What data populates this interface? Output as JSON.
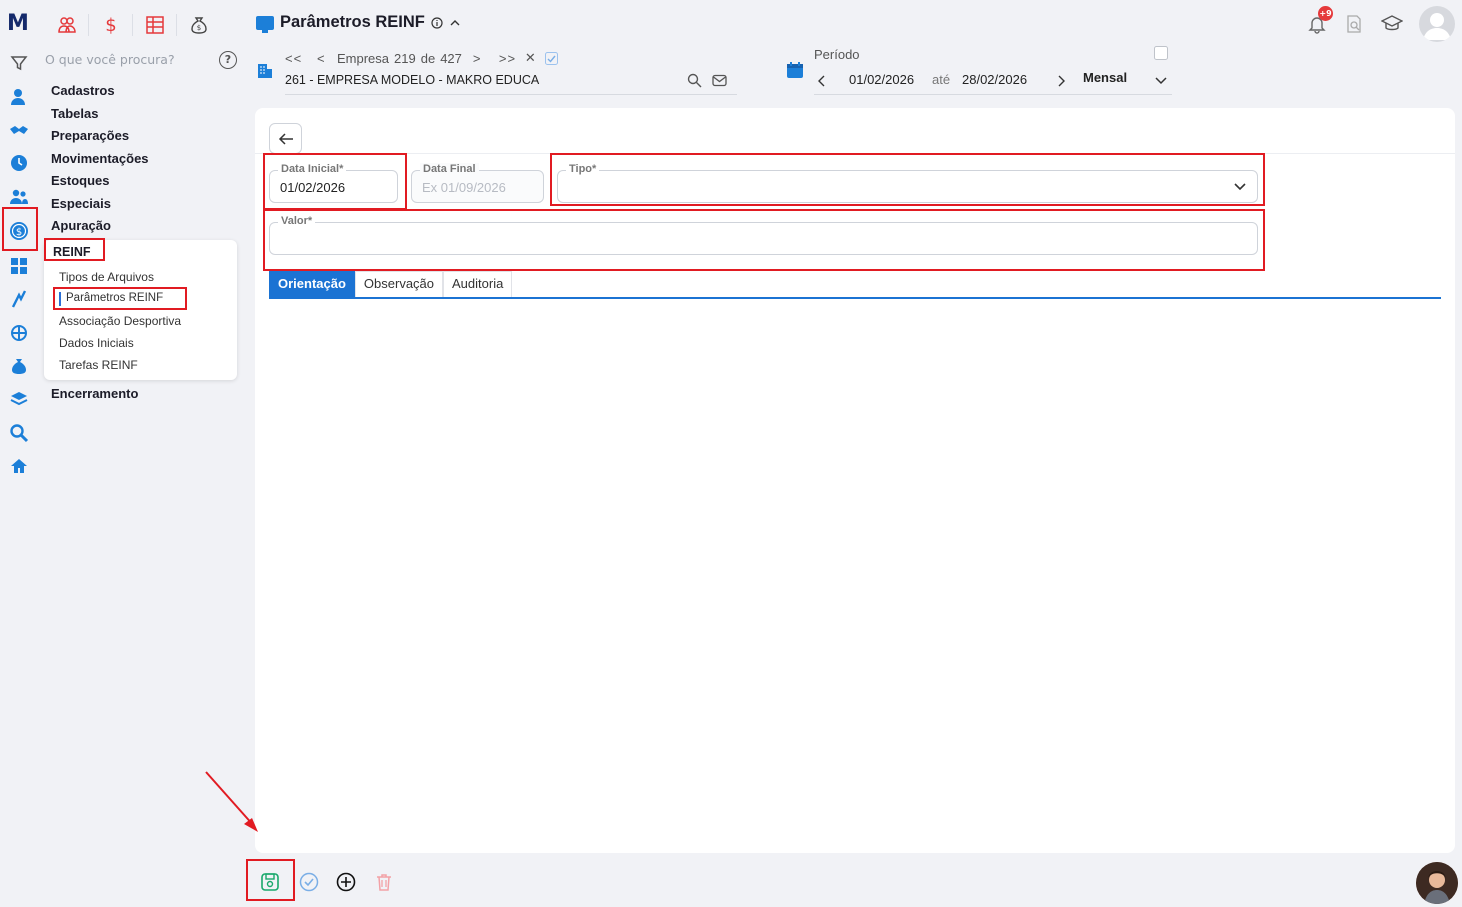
{
  "app": {
    "logo": "M"
  },
  "favorites": [
    {
      "name": "people-icon"
    },
    {
      "name": "dollar-icon",
      "glyph": "$"
    },
    {
      "name": "table-icon"
    },
    {
      "name": "money-bag-icon"
    }
  ],
  "sidebar": {
    "search_placeholder": "O que você procura?",
    "help": "?",
    "items": [
      {
        "label": "Cadastros"
      },
      {
        "label": "Tabelas"
      },
      {
        "label": "Preparações"
      },
      {
        "label": "Movimentações"
      },
      {
        "label": "Estoques"
      },
      {
        "label": "Especiais"
      },
      {
        "label": "Apuração"
      },
      {
        "label": "REINF"
      },
      {
        "label": "Encerramento"
      }
    ],
    "submenu": [
      {
        "label": "Tipos de Arquivos"
      },
      {
        "label": "Parâmetros REINF"
      },
      {
        "label": "Associação Desportiva"
      },
      {
        "label": "Dados Iniciais"
      },
      {
        "label": "Tarefas REINF"
      }
    ]
  },
  "header": {
    "title": "Parâmetros REINF",
    "empresa_nav": {
      "first": "<<",
      "prev": "<",
      "label": "Empresa",
      "current": "219",
      "of": "de",
      "total": "427",
      "next": ">",
      "last": ">>",
      "close": "✕"
    },
    "empresa_name": "261 - EMPRESA MODELO - MAKRO EDUCA",
    "periodo": {
      "label": "Período",
      "start": "01/02/2026",
      "ate": "até",
      "end": "28/02/2026",
      "mode": "Mensal"
    },
    "notifications_badge": "+9"
  },
  "form": {
    "data_inicial": {
      "label": "Data Inicial*",
      "value": "01/02/2026"
    },
    "data_final": {
      "label": "Data Final",
      "placeholder": "Ex 01/09/2026"
    },
    "tipo": {
      "label": "Tipo*",
      "value": ""
    },
    "valor": {
      "label": "Valor*",
      "value": ""
    }
  },
  "tabs": [
    {
      "label": "Orientação",
      "active": true
    },
    {
      "label": "Observação",
      "active": false
    },
    {
      "label": "Auditoria",
      "active": false
    }
  ],
  "colors": {
    "accent": "#1b73d3",
    "highlight": "#e11b22",
    "brand": "#152a6b"
  }
}
